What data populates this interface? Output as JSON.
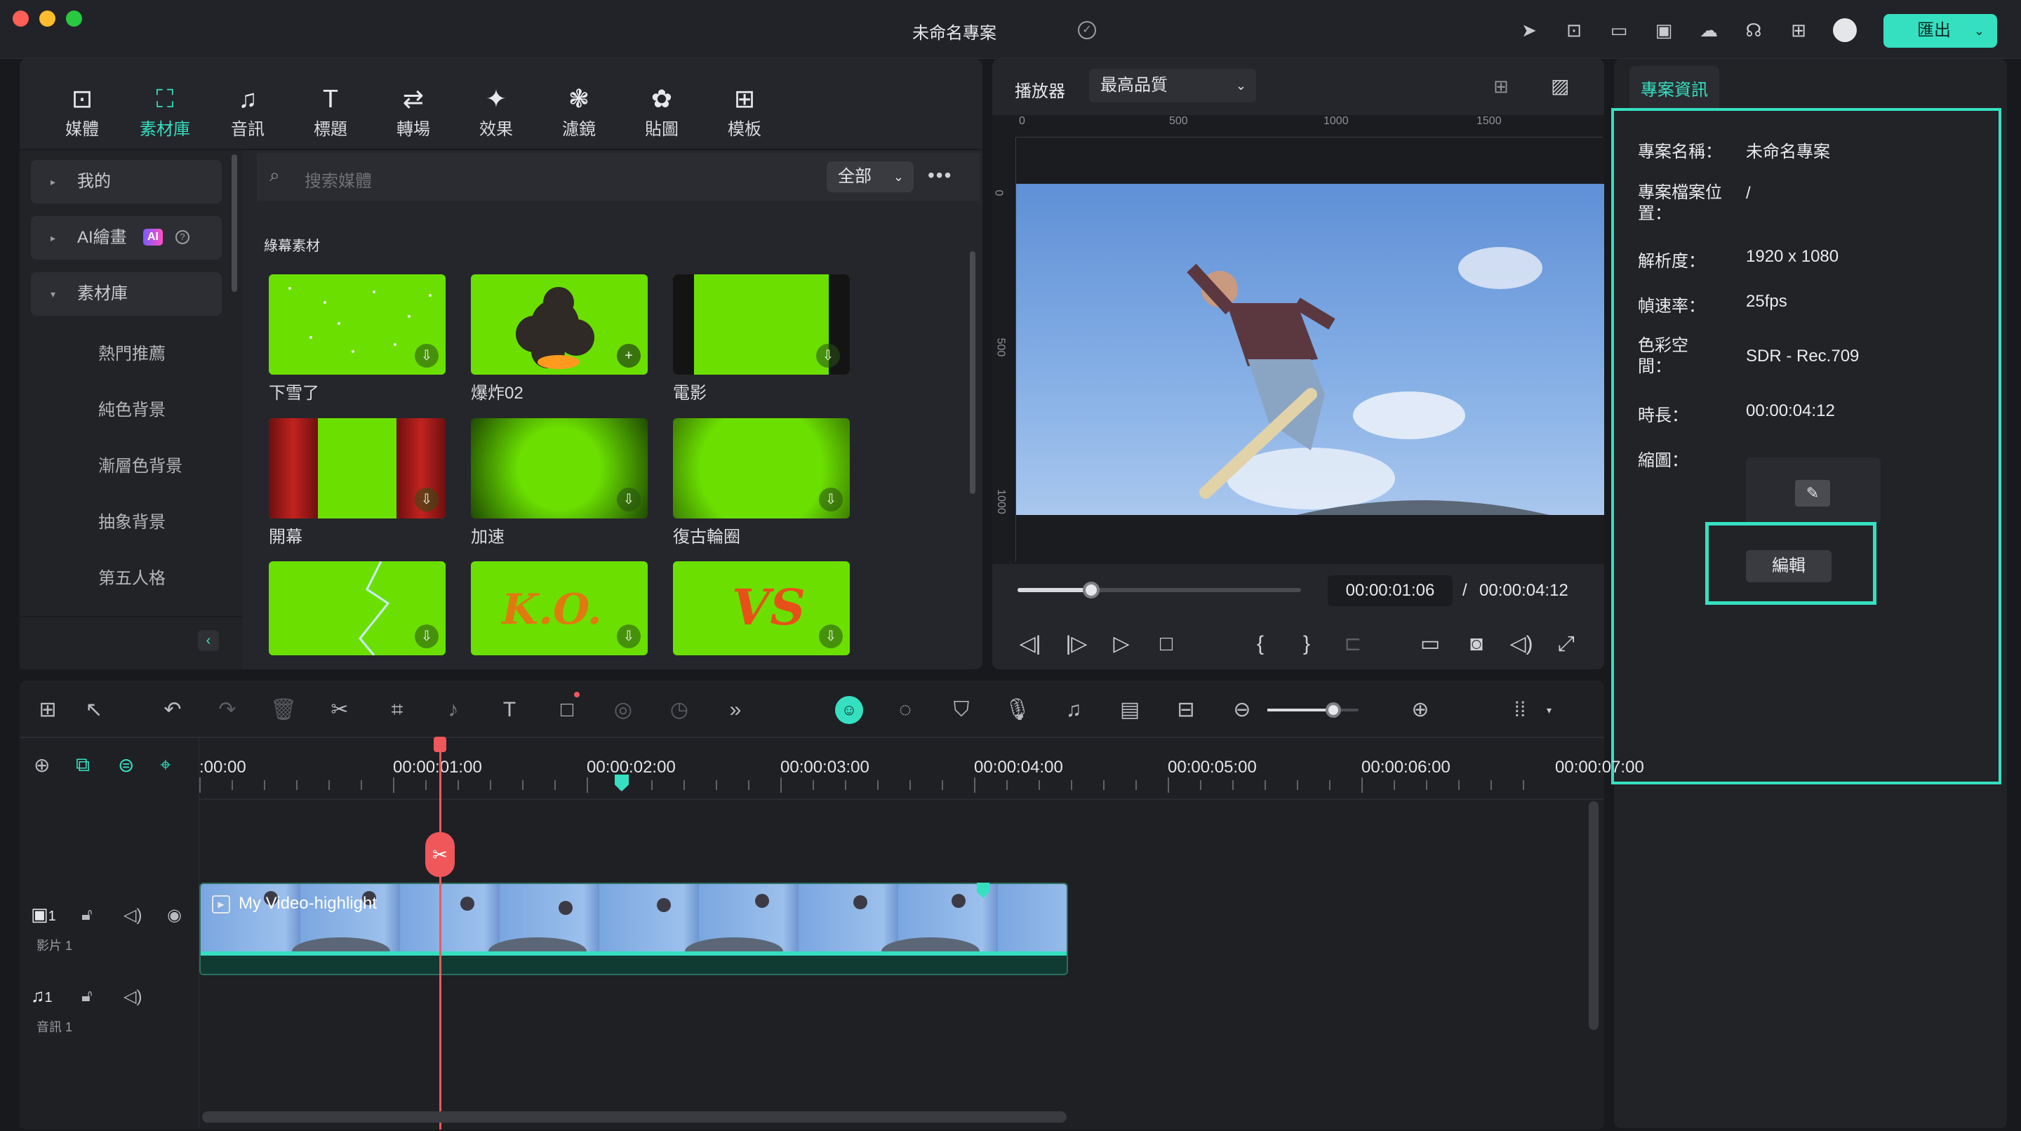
{
  "window": {
    "title": "未命名專案",
    "export_label": "匯出"
  },
  "top_tabs": [
    {
      "label": "媒體",
      "icon": "media-icon"
    },
    {
      "label": "素材庫",
      "icon": "stock-library-icon"
    },
    {
      "label": "音訊",
      "icon": "music-note-icon"
    },
    {
      "label": "標題",
      "icon": "title-text-icon"
    },
    {
      "label": "轉場",
      "icon": "transition-icon"
    },
    {
      "label": "效果",
      "icon": "effects-icon"
    },
    {
      "label": "濾鏡",
      "icon": "filters-icon"
    },
    {
      "label": "貼圖",
      "icon": "stickers-icon"
    },
    {
      "label": "模板",
      "icon": "templates-icon"
    }
  ],
  "sidebar": {
    "items": [
      {
        "label": "我的"
      },
      {
        "label": "AI繪畫"
      },
      {
        "label": "素材庫"
      }
    ],
    "ai_badge": "AI",
    "sub_items": [
      "熱門推薦",
      "純色背景",
      "漸層色背景",
      "抽象背景",
      "第五人格"
    ]
  },
  "library": {
    "search_placeholder": "搜索媒體",
    "filter_label": "全部",
    "section_title": "綠幕素材",
    "items": [
      {
        "label": "下雪了"
      },
      {
        "label": "爆炸02"
      },
      {
        "label": "電影"
      },
      {
        "label": "開幕"
      },
      {
        "label": "加速"
      },
      {
        "label": "復古輪圈"
      },
      {
        "label": ""
      },
      {
        "label": "K.O."
      },
      {
        "label": "VS"
      }
    ]
  },
  "player": {
    "label": "播放器",
    "quality": "最高品質",
    "ruler": [
      "0",
      "500",
      "1000",
      "1500"
    ],
    "vruler": [
      "0",
      "500",
      "1000"
    ],
    "current_time": "00:00:01:06",
    "separator": "/",
    "total_time": "00:00:04:12",
    "progress": 0.26
  },
  "project_info": {
    "tab_label": "專案資訊",
    "rows": [
      {
        "label": "專案名稱：",
        "value": "未命名專案"
      },
      {
        "label": "專案檔案位置：",
        "value": "/"
      },
      {
        "label": "解析度：",
        "value": "1920 x 1080"
      },
      {
        "label": "幀速率：",
        "value": "25fps"
      },
      {
        "label": "色彩空間：",
        "value": "SDR - Rec.709"
      },
      {
        "label": "時長：",
        "value": "00:00:04:12"
      },
      {
        "label": "縮圖：",
        "value": ""
      }
    ],
    "edit_label": "編輯",
    "highlight_color": "#35e0c1"
  },
  "timeline": {
    "timecodes": [
      ":00:00",
      "00:00:01:00",
      "00:00:02:00",
      "00:00:03:00",
      "00:00:04:00",
      "00:00:05:00",
      "00:00:06:00",
      "00:00:07:00"
    ],
    "video_track": {
      "number": "1",
      "name": "影片 1"
    },
    "audio_track": {
      "number": "1",
      "name": "音訊 1"
    },
    "clip_name": "My Video-highlight",
    "zoom_level": 0.72
  },
  "colors": {
    "accent": "#35e0c1",
    "playhead": "#f0575a",
    "greenscreen": "#6be000"
  }
}
